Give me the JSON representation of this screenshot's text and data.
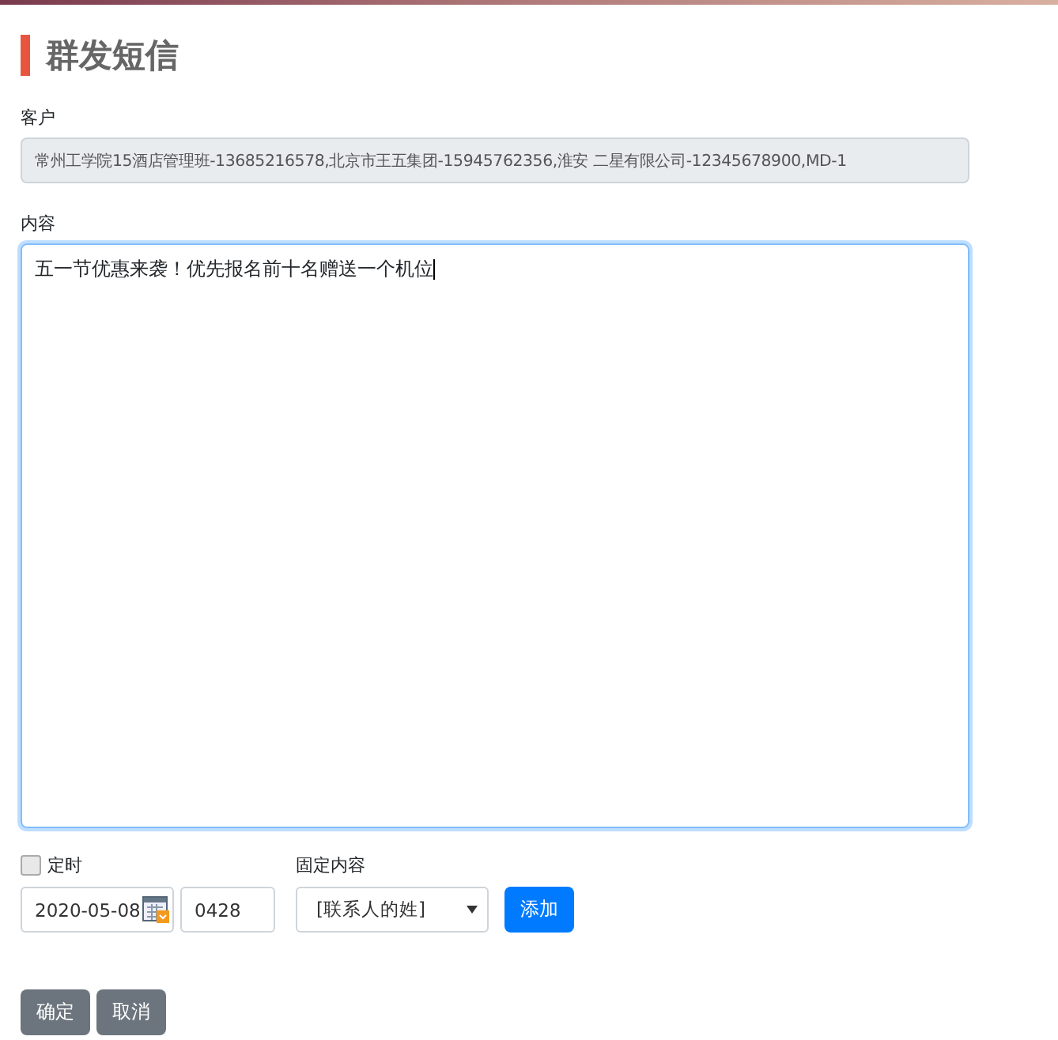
{
  "title": "群发短信",
  "customer": {
    "label": "客户",
    "value": "常州工学院15酒店管理班-13685216578,北京市王五集团-15945762356,淮安 二星有限公司-12345678900,MD-1",
    "disabled": true
  },
  "content": {
    "label": "内容",
    "value": "五一节优惠来袭！优先报名前十名赠送一个机位",
    "focused": true
  },
  "schedule": {
    "label": "定时",
    "checked": false,
    "date": "2020-05-08",
    "time": "0428"
  },
  "fixed_content": {
    "label": "固定内容",
    "value": "[联系人的姓]",
    "add_button": "添加"
  },
  "buttons": [
    {
      "label": "确定",
      "kind": "secondary"
    },
    {
      "label": "取消",
      "kind": "secondary"
    }
  ]
}
